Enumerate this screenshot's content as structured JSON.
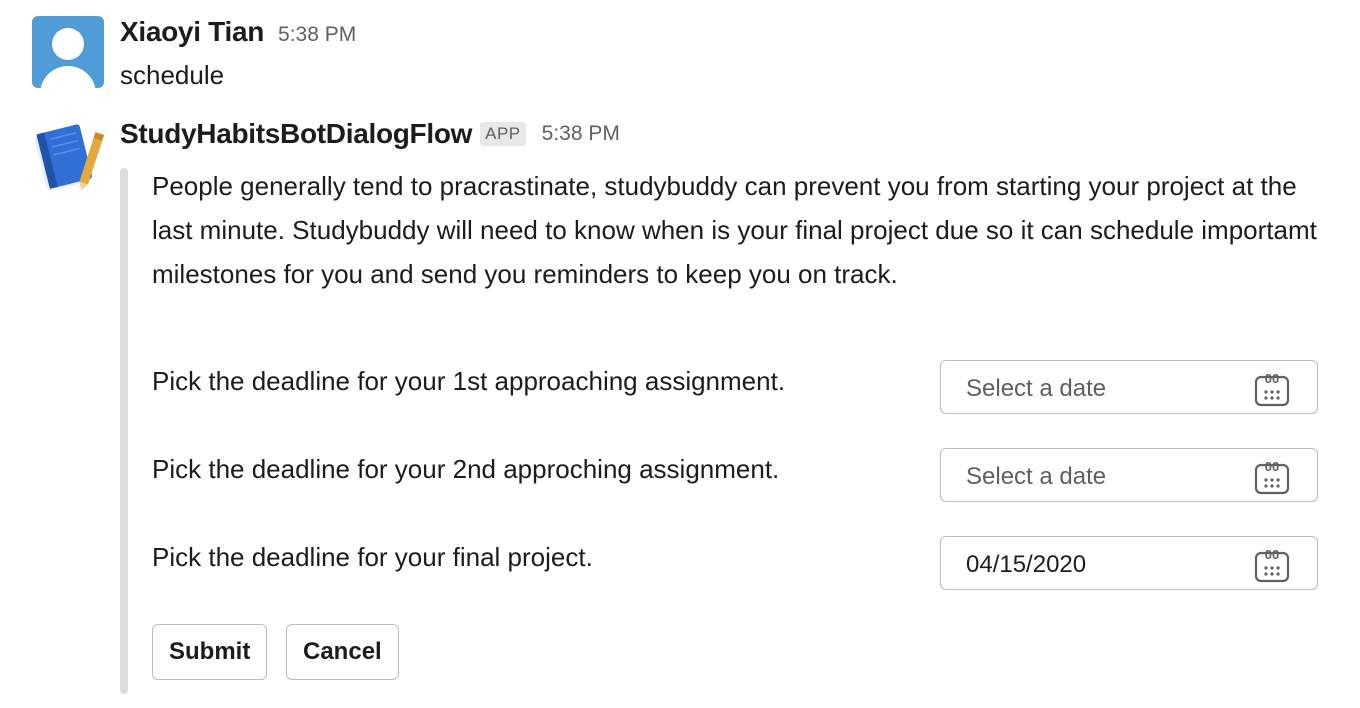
{
  "messages": {
    "user": {
      "name": "Xiaoyi Tian",
      "time": "5:38 PM",
      "text": "schedule"
    },
    "bot": {
      "name": "StudyHabitsBotDialogFlow",
      "badge": "APP",
      "time": "5:38 PM",
      "intro": "People generally tend to pracrastinate, studybuddy can prevent you from starting your project at the last minute. Studybuddy will need to know when is your final project due so it can schedule importamt milestones for you and send you reminders to keep you on track.",
      "deadlines": [
        {
          "label": "Pick the deadline for your 1st approaching assignment.",
          "value": "Select a date",
          "is_placeholder": true
        },
        {
          "label": "Pick the deadline for your 2nd approching assignment.",
          "value": "Select a date",
          "is_placeholder": true
        },
        {
          "label": "Pick the deadline for your final project.",
          "value": "04/15/2020",
          "is_placeholder": false
        }
      ],
      "submit_label": "Submit",
      "cancel_label": "Cancel"
    }
  },
  "icons": {
    "user_avatar": "default-user-avatar-icon",
    "bot_avatar": "notebook-pencil-icon",
    "date_picker": "calendar-icon"
  },
  "colors": {
    "user_avatar_bg": "#4f9cd6",
    "text": "#1d1c1d",
    "muted": "#616061",
    "attachment_bar": "#dddddd"
  }
}
